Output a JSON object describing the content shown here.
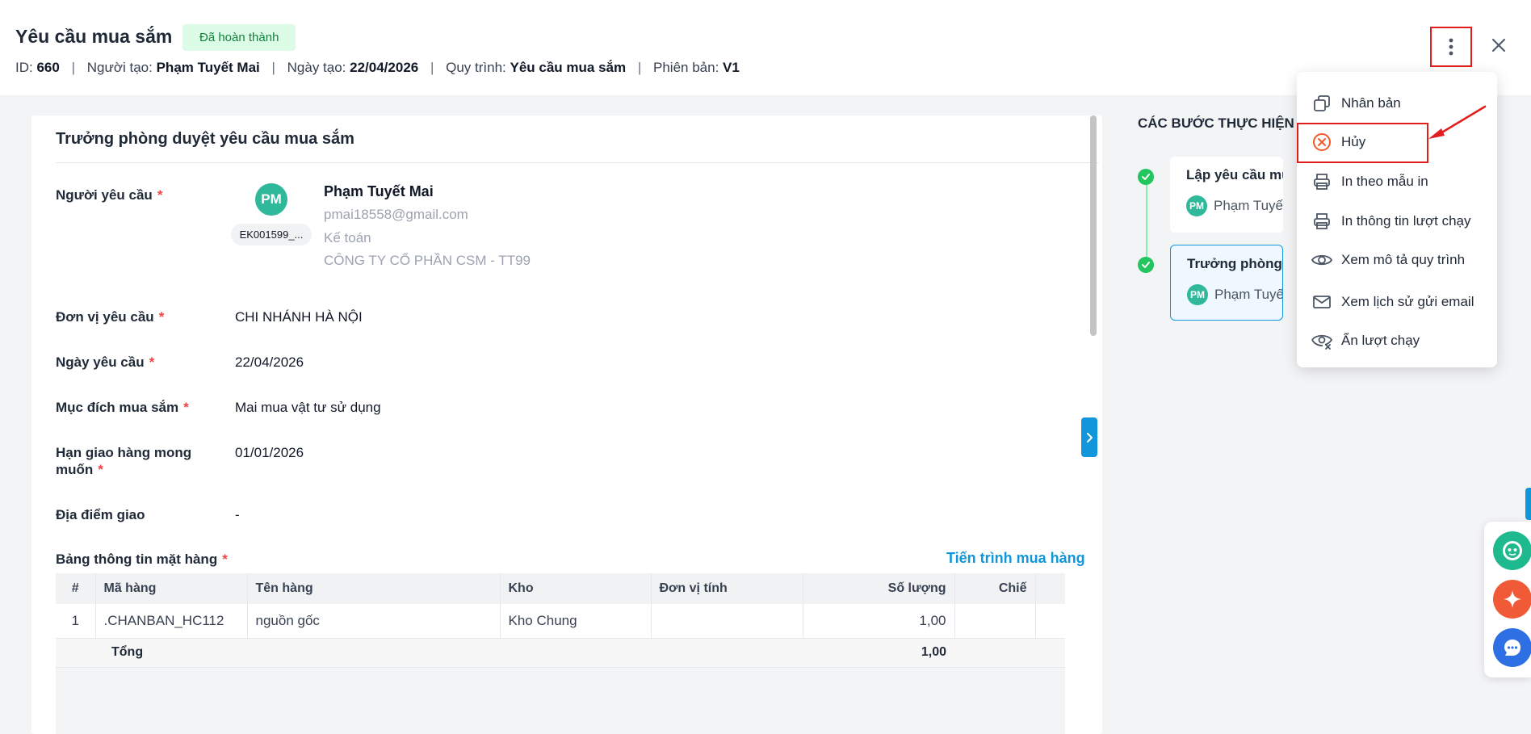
{
  "header": {
    "title": "Yêu cầu mua sắm",
    "status": "Đã hoàn thành",
    "id_label": "ID:",
    "id_value": "660",
    "creator_label": "Người tạo:",
    "creator_value": "Phạm Tuyết Mai",
    "created_date_label": "Ngày tạo:",
    "created_date_value": "22/04/2026",
    "process_label": "Quy trình:",
    "process_value": "Yêu cầu mua sắm",
    "version_label": "Phiên bản:",
    "version_value": "V1",
    "separator": "|",
    "more_icon": "more-vertical-icon",
    "close_icon": "close-icon"
  },
  "form": {
    "section_title": "Trưởng phòng duyệt yêu cầu mua sắm",
    "required_mark": "*",
    "requester_label": "Người yêu cầu",
    "requester": {
      "initials": "PM",
      "employee_code": "EK001599_...",
      "name": "Phạm Tuyết Mai",
      "email": "pmai18558@gmail.com",
      "department": "Kế toán",
      "company": "CÔNG TY CỔ PHẦN CSM - TT99"
    },
    "unit_label": "Đơn vị yêu cầu",
    "unit_value": "CHI NHÁNH HÀ NỘI",
    "date_label": "Ngày yêu cầu",
    "date_value": "22/04/2026",
    "purpose_label": "Mục đích mua sắm",
    "purpose_value": "Mai mua vật tư sử dụng",
    "deadline_label_line1": "Hạn giao hàng mong",
    "deadline_label_line2": "muốn",
    "deadline_value": "01/01/2026",
    "location_label": "Địa điểm giao",
    "location_value": "-",
    "items_label": "Bảng thông tin mặt hàng",
    "items_link": "Tiến trình mua hàng",
    "table": {
      "headers": [
        "#",
        "Mã hàng",
        "Tên hàng",
        "Kho",
        "Đơn vị tính",
        "Số lượng",
        "Chiế"
      ],
      "rows": [
        [
          "1",
          ".CHANBAN_HC112",
          "nguồn gốc",
          "Kho Chung",
          "",
          "1,00",
          ""
        ]
      ],
      "total_label": "Tổng",
      "total_quantity": "1,00"
    }
  },
  "steps": {
    "title": "CÁC BƯỚC THỰC HIỆN",
    "items": [
      {
        "title": "Lập yêu cầu mua",
        "user_initials": "PM",
        "user": "Phạm Tuyết M",
        "status": "done"
      },
      {
        "title": "Trưởng phòng duy",
        "user_initials": "PM",
        "user": "Phạm Tuyết M",
        "status": "done"
      }
    ]
  },
  "menu": {
    "items": [
      {
        "label": "Nhân bản",
        "icon": "duplicate-icon"
      },
      {
        "label": "Hủy",
        "icon": "cancel-circle-icon"
      },
      {
        "label": "In theo mẫu in",
        "icon": "printer-icon"
      },
      {
        "label": "In thông tin lượt chạy",
        "icon": "printer-icon"
      },
      {
        "label": "Xem mô tả quy trình",
        "icon": "eye-icon"
      },
      {
        "label": "Xem lịch sử gửi email",
        "icon": "mail-icon"
      },
      {
        "label": "Ẩn lượt chạy",
        "icon": "eye-hide-icon"
      }
    ]
  },
  "floating": {
    "buttons": [
      {
        "icon": "chatbot-icon",
        "color": "#1fb98f"
      },
      {
        "icon": "ai-sparkle-icon",
        "color": "#f05a37"
      },
      {
        "icon": "chat-bubble-icon",
        "color": "#2f6fe4"
      }
    ]
  },
  "colors": {
    "accent": "#1296db",
    "success": "#22c55e",
    "danger": "#e11d1d",
    "avatar": "#2fb99a"
  }
}
